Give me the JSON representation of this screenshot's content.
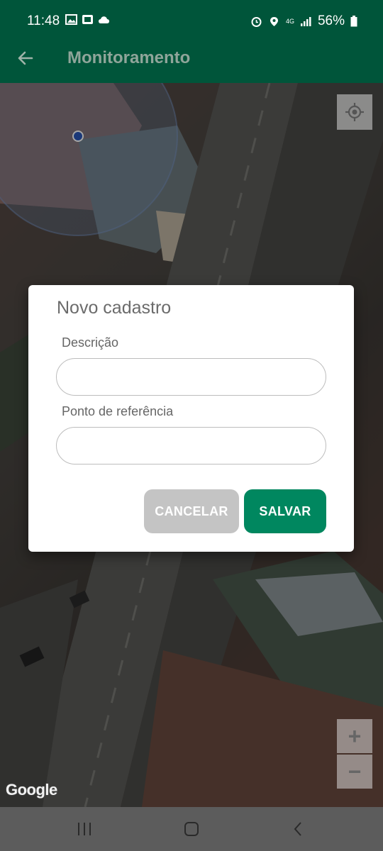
{
  "status_bar": {
    "time": "11:48",
    "battery": "56%",
    "network": "4G",
    "icons": [
      "image-icon",
      "nfc-icon",
      "cloud-icon",
      "alarm-icon",
      "location-icon",
      "signal-icon",
      "battery-icon"
    ]
  },
  "app_bar": {
    "title": "Monitoramento",
    "back_icon": "arrow-back-icon",
    "background": "#00553a"
  },
  "map": {
    "attribution": "Google",
    "zoom_in_label": "+",
    "zoom_out_label": "−",
    "controls": [
      "my-location-icon"
    ]
  },
  "dialog": {
    "title": "Novo cadastro",
    "fields": [
      {
        "label": "Descrição",
        "value": "",
        "placeholder": ""
      },
      {
        "label": "Ponto de referência",
        "value": "",
        "placeholder": ""
      }
    ],
    "cancel_label": "CANCELAR",
    "save_label": "SALVAR",
    "colors": {
      "save": "#00875f",
      "cancel": "#c4c4c4"
    }
  },
  "nav_bar": {
    "icons": [
      "recents-icon",
      "home-icon",
      "back-icon"
    ]
  }
}
